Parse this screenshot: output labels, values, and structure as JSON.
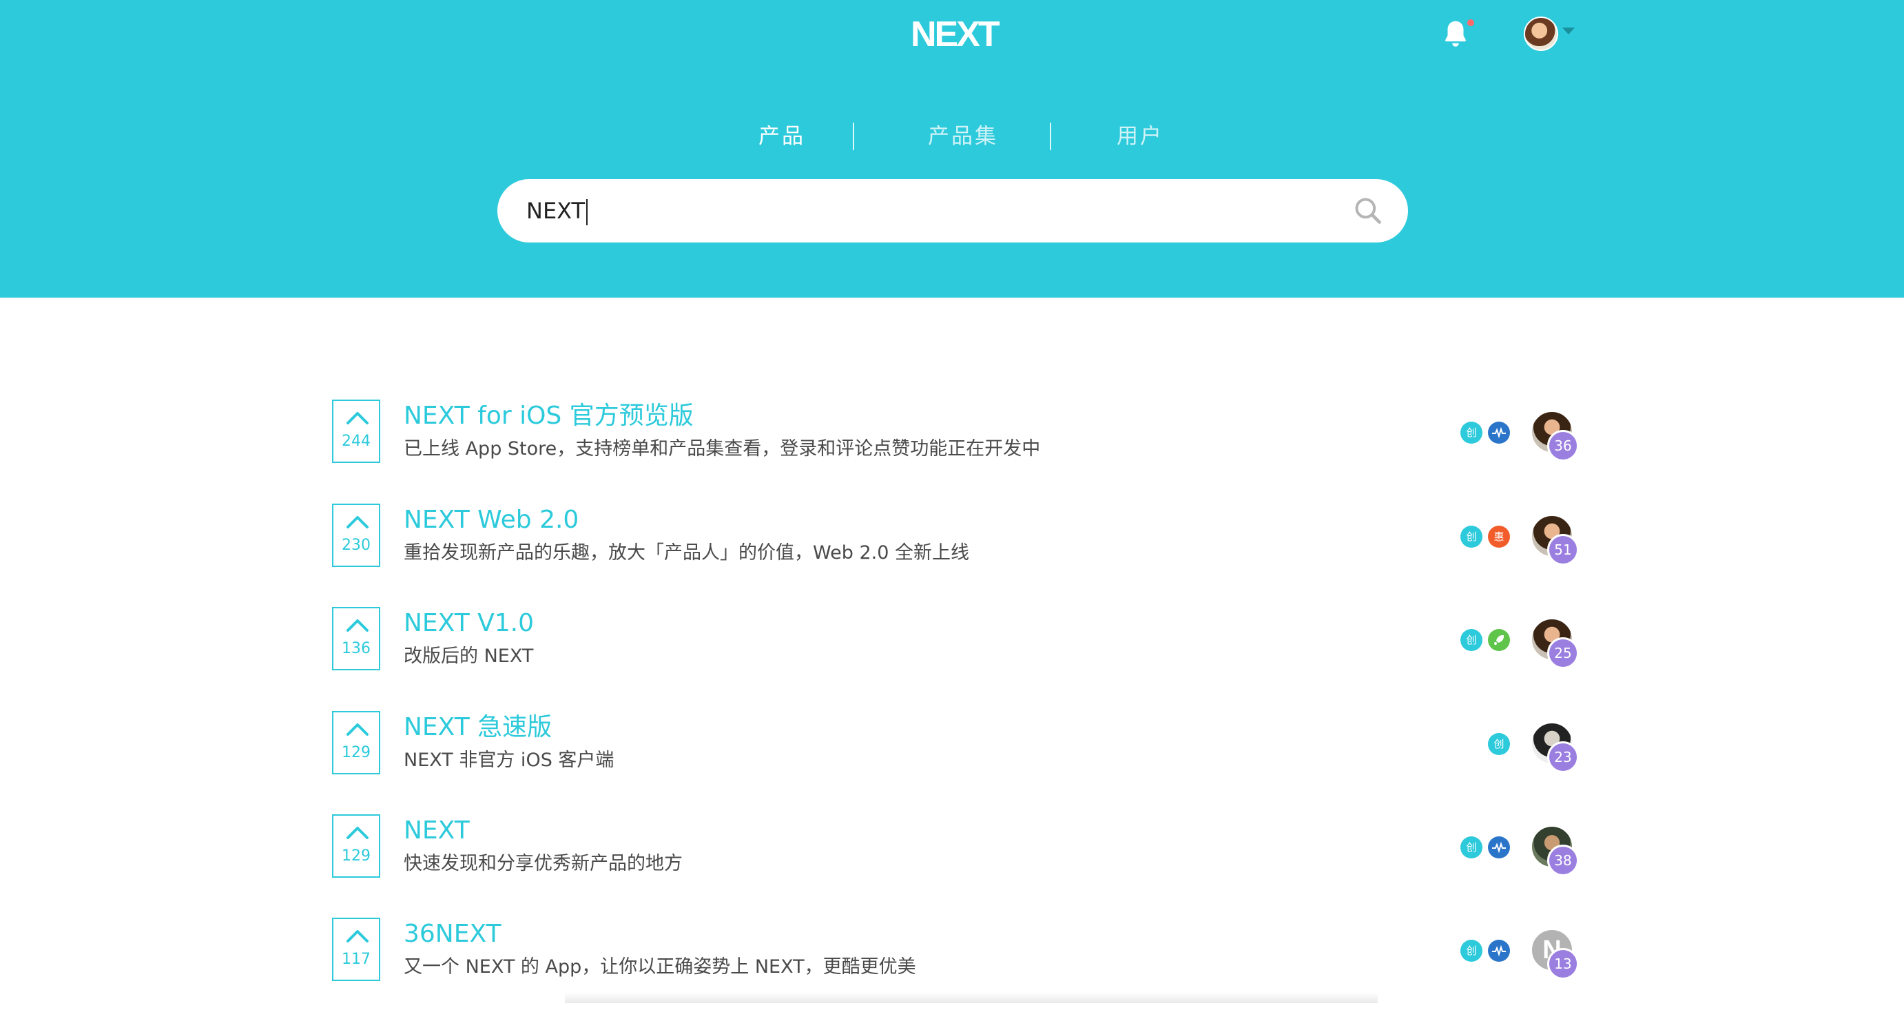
{
  "header": {
    "logo": "NEXT",
    "has_notification": true,
    "tabs": [
      {
        "label": "产品",
        "active": true
      },
      {
        "label": "产品集",
        "active": false
      },
      {
        "label": "用户",
        "active": false
      }
    ],
    "search": {
      "value": "NEXT"
    }
  },
  "colors": {
    "primary": "#2ccadb",
    "maker_count": "#9b7fe0",
    "badge_create": "#2ccadb",
    "badge_pulse": "#2a75c9",
    "badge_discount": "#f25c2b",
    "badge_rocket": "#5ec44a"
  },
  "products": [
    {
      "votes": "244",
      "title": "NEXT for iOS 官方预览版",
      "desc": "已上线 App Store，支持榜单和产品集查看，登录和评论点赞功能正在开发中",
      "badges": [
        {
          "type": "chuang",
          "text": "创"
        },
        {
          "type": "pulse",
          "icon": "pulse-icon"
        }
      ],
      "maker_count": "36",
      "avatar": "photo"
    },
    {
      "votes": "230",
      "title": "NEXT Web 2.0",
      "desc": "重拾发现新产品的乐趣，放大「产品人」的价值，Web 2.0 全新上线",
      "badges": [
        {
          "type": "chuang",
          "text": "创"
        },
        {
          "type": "hui",
          "text": "惠"
        }
      ],
      "maker_count": "51",
      "avatar": "photo"
    },
    {
      "votes": "136",
      "title": "NEXT V1.0",
      "desc": "改版后的 NEXT",
      "badges": [
        {
          "type": "chuang",
          "text": "创"
        },
        {
          "type": "rocket",
          "icon": "rocket-icon"
        }
      ],
      "maker_count": "25",
      "avatar": "photo"
    },
    {
      "votes": "129",
      "title": "NEXT 急速版",
      "desc": "NEXT 非官方 iOS 客户端",
      "badges": [
        {
          "type": "chuang",
          "text": "创"
        }
      ],
      "maker_count": "23",
      "avatar": "photo"
    },
    {
      "votes": "129",
      "title": "NEXT",
      "desc": "快速发现和分享优秀新产品的地方",
      "badges": [
        {
          "type": "chuang",
          "text": "创"
        },
        {
          "type": "pulse",
          "icon": "pulse-icon"
        }
      ],
      "maker_count": "38",
      "avatar": "photo"
    },
    {
      "votes": "117",
      "title": "36NEXT",
      "desc": "又一个 NEXT 的 App，让你以正确姿势上 NEXT，更酷更优美",
      "badges": [
        {
          "type": "chuang",
          "text": "创"
        },
        {
          "type": "pulse",
          "icon": "pulse-icon"
        }
      ],
      "maker_count": "13",
      "avatar": "letter",
      "avatar_letter": "N"
    }
  ]
}
